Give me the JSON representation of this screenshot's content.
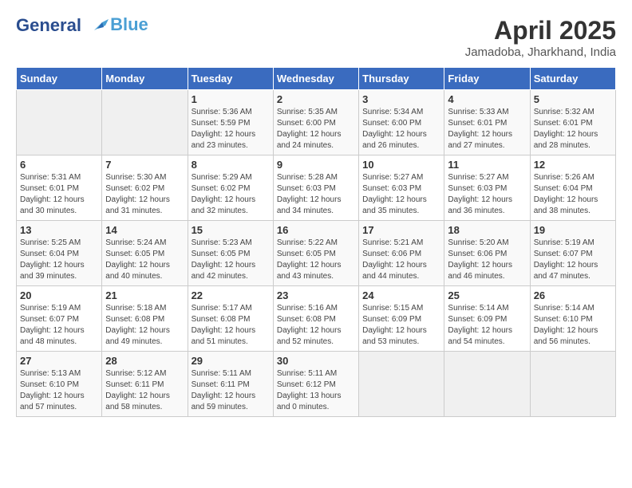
{
  "header": {
    "logo_line1": "General",
    "logo_line2": "Blue",
    "month_title": "April 2025",
    "location": "Jamadoba, Jharkhand, India"
  },
  "weekdays": [
    "Sunday",
    "Monday",
    "Tuesday",
    "Wednesday",
    "Thursday",
    "Friday",
    "Saturday"
  ],
  "weeks": [
    [
      {
        "day": "",
        "sunrise": "",
        "sunset": "",
        "daylight": "",
        "empty": true
      },
      {
        "day": "",
        "sunrise": "",
        "sunset": "",
        "daylight": "",
        "empty": true
      },
      {
        "day": "1",
        "sunrise": "Sunrise: 5:36 AM",
        "sunset": "Sunset: 5:59 PM",
        "daylight": "Daylight: 12 hours and 23 minutes.",
        "empty": false
      },
      {
        "day": "2",
        "sunrise": "Sunrise: 5:35 AM",
        "sunset": "Sunset: 6:00 PM",
        "daylight": "Daylight: 12 hours and 24 minutes.",
        "empty": false
      },
      {
        "day": "3",
        "sunrise": "Sunrise: 5:34 AM",
        "sunset": "Sunset: 6:00 PM",
        "daylight": "Daylight: 12 hours and 26 minutes.",
        "empty": false
      },
      {
        "day": "4",
        "sunrise": "Sunrise: 5:33 AM",
        "sunset": "Sunset: 6:01 PM",
        "daylight": "Daylight: 12 hours and 27 minutes.",
        "empty": false
      },
      {
        "day": "5",
        "sunrise": "Sunrise: 5:32 AM",
        "sunset": "Sunset: 6:01 PM",
        "daylight": "Daylight: 12 hours and 28 minutes.",
        "empty": false
      }
    ],
    [
      {
        "day": "6",
        "sunrise": "Sunrise: 5:31 AM",
        "sunset": "Sunset: 6:01 PM",
        "daylight": "Daylight: 12 hours and 30 minutes.",
        "empty": false
      },
      {
        "day": "7",
        "sunrise": "Sunrise: 5:30 AM",
        "sunset": "Sunset: 6:02 PM",
        "daylight": "Daylight: 12 hours and 31 minutes.",
        "empty": false
      },
      {
        "day": "8",
        "sunrise": "Sunrise: 5:29 AM",
        "sunset": "Sunset: 6:02 PM",
        "daylight": "Daylight: 12 hours and 32 minutes.",
        "empty": false
      },
      {
        "day": "9",
        "sunrise": "Sunrise: 5:28 AM",
        "sunset": "Sunset: 6:03 PM",
        "daylight": "Daylight: 12 hours and 34 minutes.",
        "empty": false
      },
      {
        "day": "10",
        "sunrise": "Sunrise: 5:27 AM",
        "sunset": "Sunset: 6:03 PM",
        "daylight": "Daylight: 12 hours and 35 minutes.",
        "empty": false
      },
      {
        "day": "11",
        "sunrise": "Sunrise: 5:27 AM",
        "sunset": "Sunset: 6:03 PM",
        "daylight": "Daylight: 12 hours and 36 minutes.",
        "empty": false
      },
      {
        "day": "12",
        "sunrise": "Sunrise: 5:26 AM",
        "sunset": "Sunset: 6:04 PM",
        "daylight": "Daylight: 12 hours and 38 minutes.",
        "empty": false
      }
    ],
    [
      {
        "day": "13",
        "sunrise": "Sunrise: 5:25 AM",
        "sunset": "Sunset: 6:04 PM",
        "daylight": "Daylight: 12 hours and 39 minutes.",
        "empty": false
      },
      {
        "day": "14",
        "sunrise": "Sunrise: 5:24 AM",
        "sunset": "Sunset: 6:05 PM",
        "daylight": "Daylight: 12 hours and 40 minutes.",
        "empty": false
      },
      {
        "day": "15",
        "sunrise": "Sunrise: 5:23 AM",
        "sunset": "Sunset: 6:05 PM",
        "daylight": "Daylight: 12 hours and 42 minutes.",
        "empty": false
      },
      {
        "day": "16",
        "sunrise": "Sunrise: 5:22 AM",
        "sunset": "Sunset: 6:05 PM",
        "daylight": "Daylight: 12 hours and 43 minutes.",
        "empty": false
      },
      {
        "day": "17",
        "sunrise": "Sunrise: 5:21 AM",
        "sunset": "Sunset: 6:06 PM",
        "daylight": "Daylight: 12 hours and 44 minutes.",
        "empty": false
      },
      {
        "day": "18",
        "sunrise": "Sunrise: 5:20 AM",
        "sunset": "Sunset: 6:06 PM",
        "daylight": "Daylight: 12 hours and 46 minutes.",
        "empty": false
      },
      {
        "day": "19",
        "sunrise": "Sunrise: 5:19 AM",
        "sunset": "Sunset: 6:07 PM",
        "daylight": "Daylight: 12 hours and 47 minutes.",
        "empty": false
      }
    ],
    [
      {
        "day": "20",
        "sunrise": "Sunrise: 5:19 AM",
        "sunset": "Sunset: 6:07 PM",
        "daylight": "Daylight: 12 hours and 48 minutes.",
        "empty": false
      },
      {
        "day": "21",
        "sunrise": "Sunrise: 5:18 AM",
        "sunset": "Sunset: 6:08 PM",
        "daylight": "Daylight: 12 hours and 49 minutes.",
        "empty": false
      },
      {
        "day": "22",
        "sunrise": "Sunrise: 5:17 AM",
        "sunset": "Sunset: 6:08 PM",
        "daylight": "Daylight: 12 hours and 51 minutes.",
        "empty": false
      },
      {
        "day": "23",
        "sunrise": "Sunrise: 5:16 AM",
        "sunset": "Sunset: 6:08 PM",
        "daylight": "Daylight: 12 hours and 52 minutes.",
        "empty": false
      },
      {
        "day": "24",
        "sunrise": "Sunrise: 5:15 AM",
        "sunset": "Sunset: 6:09 PM",
        "daylight": "Daylight: 12 hours and 53 minutes.",
        "empty": false
      },
      {
        "day": "25",
        "sunrise": "Sunrise: 5:14 AM",
        "sunset": "Sunset: 6:09 PM",
        "daylight": "Daylight: 12 hours and 54 minutes.",
        "empty": false
      },
      {
        "day": "26",
        "sunrise": "Sunrise: 5:14 AM",
        "sunset": "Sunset: 6:10 PM",
        "daylight": "Daylight: 12 hours and 56 minutes.",
        "empty": false
      }
    ],
    [
      {
        "day": "27",
        "sunrise": "Sunrise: 5:13 AM",
        "sunset": "Sunset: 6:10 PM",
        "daylight": "Daylight: 12 hours and 57 minutes.",
        "empty": false
      },
      {
        "day": "28",
        "sunrise": "Sunrise: 5:12 AM",
        "sunset": "Sunset: 6:11 PM",
        "daylight": "Daylight: 12 hours and 58 minutes.",
        "empty": false
      },
      {
        "day": "29",
        "sunrise": "Sunrise: 5:11 AM",
        "sunset": "Sunset: 6:11 PM",
        "daylight": "Daylight: 12 hours and 59 minutes.",
        "empty": false
      },
      {
        "day": "30",
        "sunrise": "Sunrise: 5:11 AM",
        "sunset": "Sunset: 6:12 PM",
        "daylight": "Daylight: 13 hours and 0 minutes.",
        "empty": false
      },
      {
        "day": "",
        "sunrise": "",
        "sunset": "",
        "daylight": "",
        "empty": true
      },
      {
        "day": "",
        "sunrise": "",
        "sunset": "",
        "daylight": "",
        "empty": true
      },
      {
        "day": "",
        "sunrise": "",
        "sunset": "",
        "daylight": "",
        "empty": true
      }
    ]
  ]
}
